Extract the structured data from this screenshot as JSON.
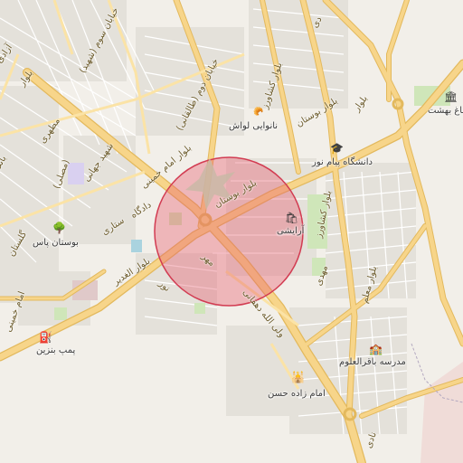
{
  "poi": {
    "behesht": "باغ بهشت",
    "lavash": "نانوایی لواش",
    "payamnoor": "دانشگاه پیام نور",
    "arayeshi": "آرایشی",
    "bostan_pas": "بوستان پاس",
    "gas": "پمپ بنزین",
    "bagher": "مدرسه باقرالعلوم",
    "emamzadeh": "امام زاده حسن"
  },
  "roads": {
    "r1": "خیابان سوم (شهید)",
    "r2": "خیابان دوم (طالقانی)",
    "r3": "بلوار کشاورز",
    "r4": "بلوار بوستان",
    "r5": "بلوار بوستان",
    "r6": "بلوار کشاورز",
    "r7": "بلوار امام خمینی",
    "r8": "دادگاه",
    "r9": "ستاری",
    "r10": "بلوار الغدیر",
    "r11": "مهر",
    "r12": "نور",
    "r13": "ولی الله دهقانی",
    "r14": "بلوار معلم",
    "r15": "مطهری",
    "r16": "آزادی",
    "r17": "بلوار",
    "r18": "مهدی",
    "r19": "شهید جهانی",
    "r20": "بانک",
    "r21": "امام خمینی",
    "r22": "بلوار",
    "r23": "گلستان",
    "r24": "(مصلی)",
    "r25": "نادی",
    "r26": "دی"
  },
  "icons": {
    "behesht": "landmark-icon",
    "lavash": "bakery-icon",
    "payamnoor": "university-icon",
    "arayeshi": "shop-icon",
    "bostan_pas": "park-tree-icon",
    "gas": "fuel-pump-icon",
    "bagher": "school-icon",
    "emamzadeh": "shrine-icon"
  },
  "colors": {
    "background": "#f2efe9",
    "major_road": "#f7d58a",
    "road_casing": "#e3b95d",
    "highlight_fill": "#e85a6b",
    "highlight_stroke": "#d23c52"
  }
}
